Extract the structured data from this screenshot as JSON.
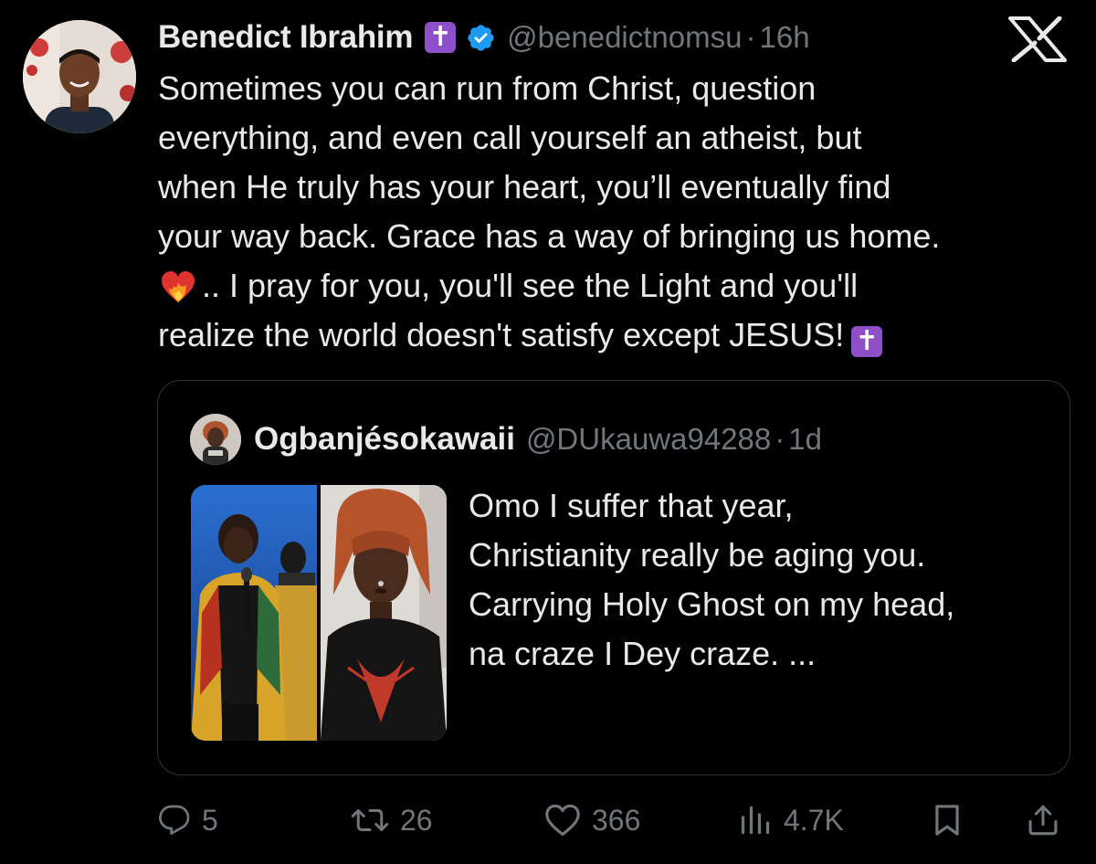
{
  "tweet": {
    "author": {
      "display_name": "Benedict Ibrahim",
      "name_emoji": "✝",
      "handle": "@benedictnomsu",
      "separator": "·",
      "time": "16h",
      "verified": true,
      "verified_color": "#1d9bf0"
    },
    "text_lines": [
      "Sometimes you can run from Christ, question",
      "everything, and even call yourself an atheist, but",
      "when He truly has your heart, you’ll eventually find",
      "your way back. Grace has a way of bringing us home.",
      ".. I pray for you, you'll see the Light and you'll",
      "realize the world doesn't satisfy except JESUS!"
    ],
    "line5_emoji": "heart-on-fire",
    "end_emoji": "✝",
    "quote": {
      "display_name": "Ogbanjésokawaii",
      "handle": "@DUkauwa94288",
      "separator": "·",
      "time": "1d",
      "text_lines": [
        "Omo I suffer that year,",
        "Christianity really be aging you.",
        "Carrying Holy Ghost on my head,",
        "na craze I Dey craze. ..."
      ]
    },
    "actions": {
      "replies": "5",
      "reposts": "26",
      "likes": "366",
      "views": "4.7K"
    }
  },
  "brand": {
    "logo": "x-logo"
  },
  "colors": {
    "background": "#000000",
    "text": "#e7e9ea",
    "muted": "#71767b",
    "border": "#2f3336",
    "cross_emoji_bg": "#8e50c9",
    "verified": "#1d9bf0"
  }
}
